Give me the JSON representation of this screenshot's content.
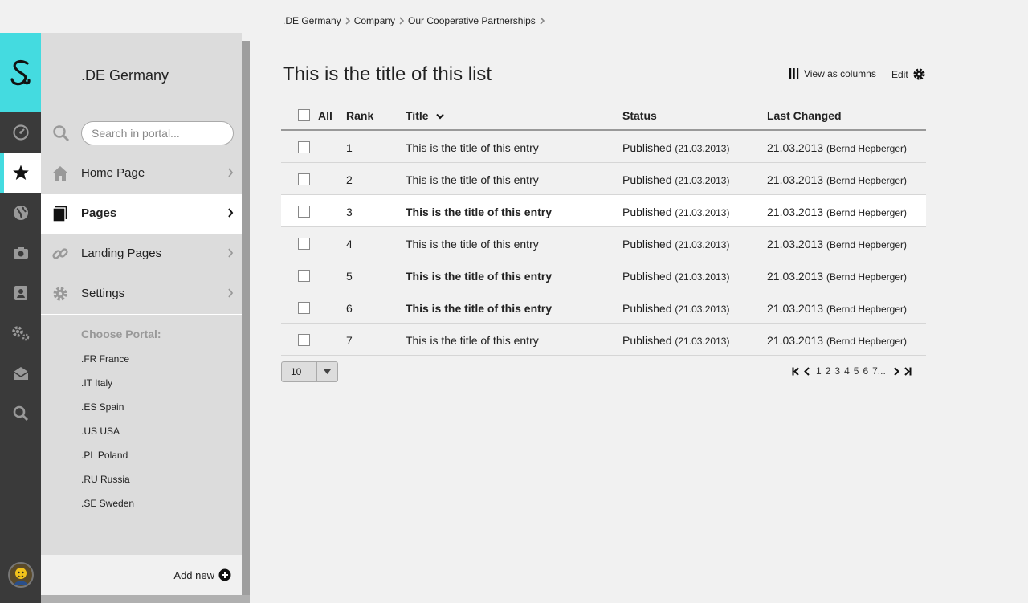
{
  "breadcrumb": [
    ".DE Germany",
    "Company",
    "Our Cooperative Partnerships"
  ],
  "rail": {
    "logo_icon": "s-logo-icon",
    "items": [
      "dashboard-icon",
      "star-icon",
      "globe-icon",
      "camera-icon",
      "contacts-icon",
      "settings-gears-icon",
      "mail-icon",
      "search-icon"
    ],
    "active_index": 1,
    "accent_color": "#44dbe0"
  },
  "side": {
    "portal_title": ".DE Germany",
    "search_placeholder": "Search in portal...",
    "nav": [
      {
        "label": "Home Page",
        "icon": "home-icon"
      },
      {
        "label": "Pages",
        "icon": "pages-icon",
        "active": true
      },
      {
        "label": "Landing Pages",
        "icon": "link-icon"
      },
      {
        "label": "Settings",
        "icon": "gear-icon"
      }
    ],
    "choose_label": "Choose Portal:",
    "portals": [
      ".FR France",
      ".IT Italy",
      ".ES Spain",
      ".US USA",
      ".PL Poland",
      ".RU Russia",
      ".SE Sweden"
    ],
    "add_new": "Add new"
  },
  "main": {
    "title": "This is the title of this list",
    "view_as_columns": "View as columns",
    "edit": "Edit",
    "table": {
      "headers": {
        "all": "All",
        "rank": "Rank",
        "title": "Title",
        "status": "Status",
        "last_changed": "Last Changed"
      },
      "rows": [
        {
          "rank": "1",
          "title": "This is the title of this entry",
          "bold": false,
          "status": "Published",
          "status_date": "(21.03.2013)",
          "changed": "21.03.2013",
          "changed_by": "(Bernd Hepberger)"
        },
        {
          "rank": "2",
          "title": "This is the title of this entry",
          "bold": false,
          "status": "Published",
          "status_date": "(21.03.2013)",
          "changed": "21.03.2013",
          "changed_by": "(Bernd Hepberger)"
        },
        {
          "rank": "3",
          "title": "This is the title of this entry",
          "bold": true,
          "status": "Published",
          "status_date": "(21.03.2013)",
          "changed": "21.03.2013",
          "changed_by": "(Bernd Hepberger)"
        },
        {
          "rank": "4",
          "title": "This is the title of this entry",
          "bold": false,
          "status": "Published",
          "status_date": "(21.03.2013)",
          "changed": "21.03.2013",
          "changed_by": "(Bernd Hepberger)"
        },
        {
          "rank": "5",
          "title": "This is the title of this entry",
          "bold": true,
          "status": "Published",
          "status_date": "(21.03.2013)",
          "changed": "21.03.2013",
          "changed_by": "(Bernd Hepberger)"
        },
        {
          "rank": "6",
          "title": "This is the title of this entry",
          "bold": true,
          "status": "Published",
          "status_date": "(21.03.2013)",
          "changed": "21.03.2013",
          "changed_by": "(Bernd Hepberger)"
        },
        {
          "rank": "7",
          "title": "This is the title of this entry",
          "bold": false,
          "status": "Published",
          "status_date": "(21.03.2013)",
          "changed": "21.03.2013",
          "changed_by": "(Bernd Hepberger)"
        }
      ]
    },
    "per_page": "10",
    "pagination": {
      "pages": [
        "1",
        "2",
        "3",
        "4",
        "5",
        "6",
        "7..."
      ]
    }
  }
}
